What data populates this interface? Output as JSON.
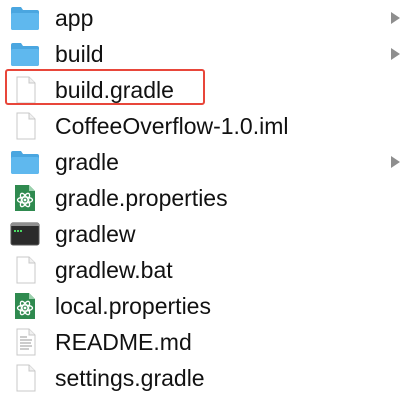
{
  "files": [
    {
      "name": "app",
      "icon": "folder-icon",
      "expandable": true
    },
    {
      "name": "build",
      "icon": "folder-icon",
      "expandable": true
    },
    {
      "name": "build.gradle",
      "icon": "document-icon",
      "expandable": false,
      "highlighted": true
    },
    {
      "name": "CoffeeOverflow-1.0.iml",
      "icon": "document-icon",
      "expandable": false
    },
    {
      "name": "gradle",
      "icon": "folder-icon",
      "expandable": true
    },
    {
      "name": "gradle.properties",
      "icon": "atom-icon",
      "expandable": false
    },
    {
      "name": "gradlew",
      "icon": "terminal-icon",
      "expandable": false
    },
    {
      "name": "gradlew.bat",
      "icon": "document-icon",
      "expandable": false
    },
    {
      "name": "local.properties",
      "icon": "atom-icon",
      "expandable": false
    },
    {
      "name": "README.md",
      "icon": "text-document-icon",
      "expandable": false
    },
    {
      "name": "settings.gradle",
      "icon": "document-icon",
      "expandable": false
    }
  ],
  "colors": {
    "folder": "#5fb8ee",
    "folder_tab": "#4aa6e0",
    "highlight": "#e8463a",
    "atom_bg": "#2f8a4f",
    "terminal_bg": "#2b2b2b",
    "chevron": "#8e8e8e"
  }
}
